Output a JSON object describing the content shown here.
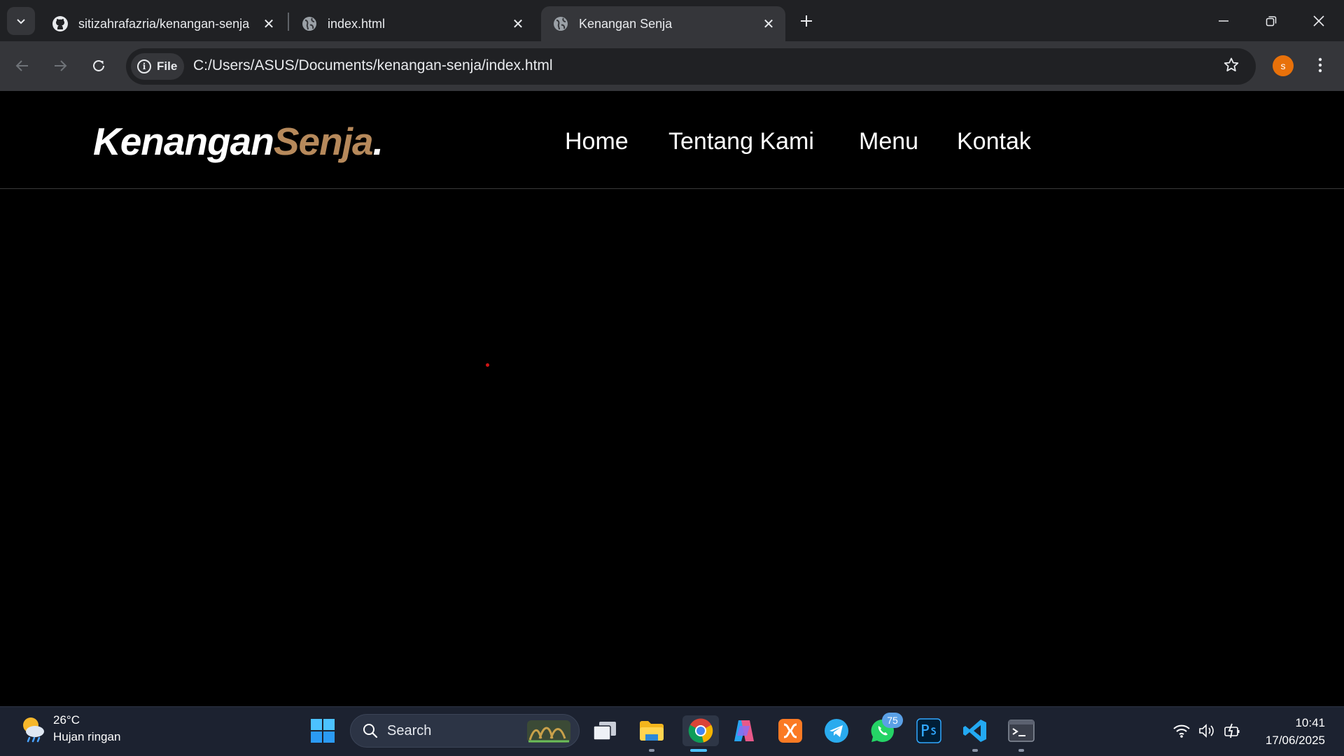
{
  "browser": {
    "tabs": [
      {
        "title": "sitizahrafazria/kenangan-senja",
        "icon": "github-icon",
        "active": false
      },
      {
        "title": "index.html",
        "icon": "globe-icon",
        "active": false
      },
      {
        "title": "Kenangan Senja",
        "icon": "globe-icon",
        "active": true
      }
    ],
    "site_chip": "File",
    "url": "C:/Users/ASUS/Documents/kenangan-senja/index.html",
    "profile_initial": "s",
    "profile_color": "#e8710a"
  },
  "site": {
    "logo_main": "Kenangan",
    "logo_accent": "Senja",
    "logo_dot": ".",
    "accent_color": "#b6895b",
    "nav": [
      "Home",
      "Tentang Kami",
      "Menu",
      "Kontak"
    ]
  },
  "taskbar": {
    "weather_temp": "26°C",
    "weather_desc": "Hujan ringan",
    "search_label": "Search",
    "whatsapp_badge": "75",
    "time": "10:41",
    "date": "17/06/2025"
  }
}
